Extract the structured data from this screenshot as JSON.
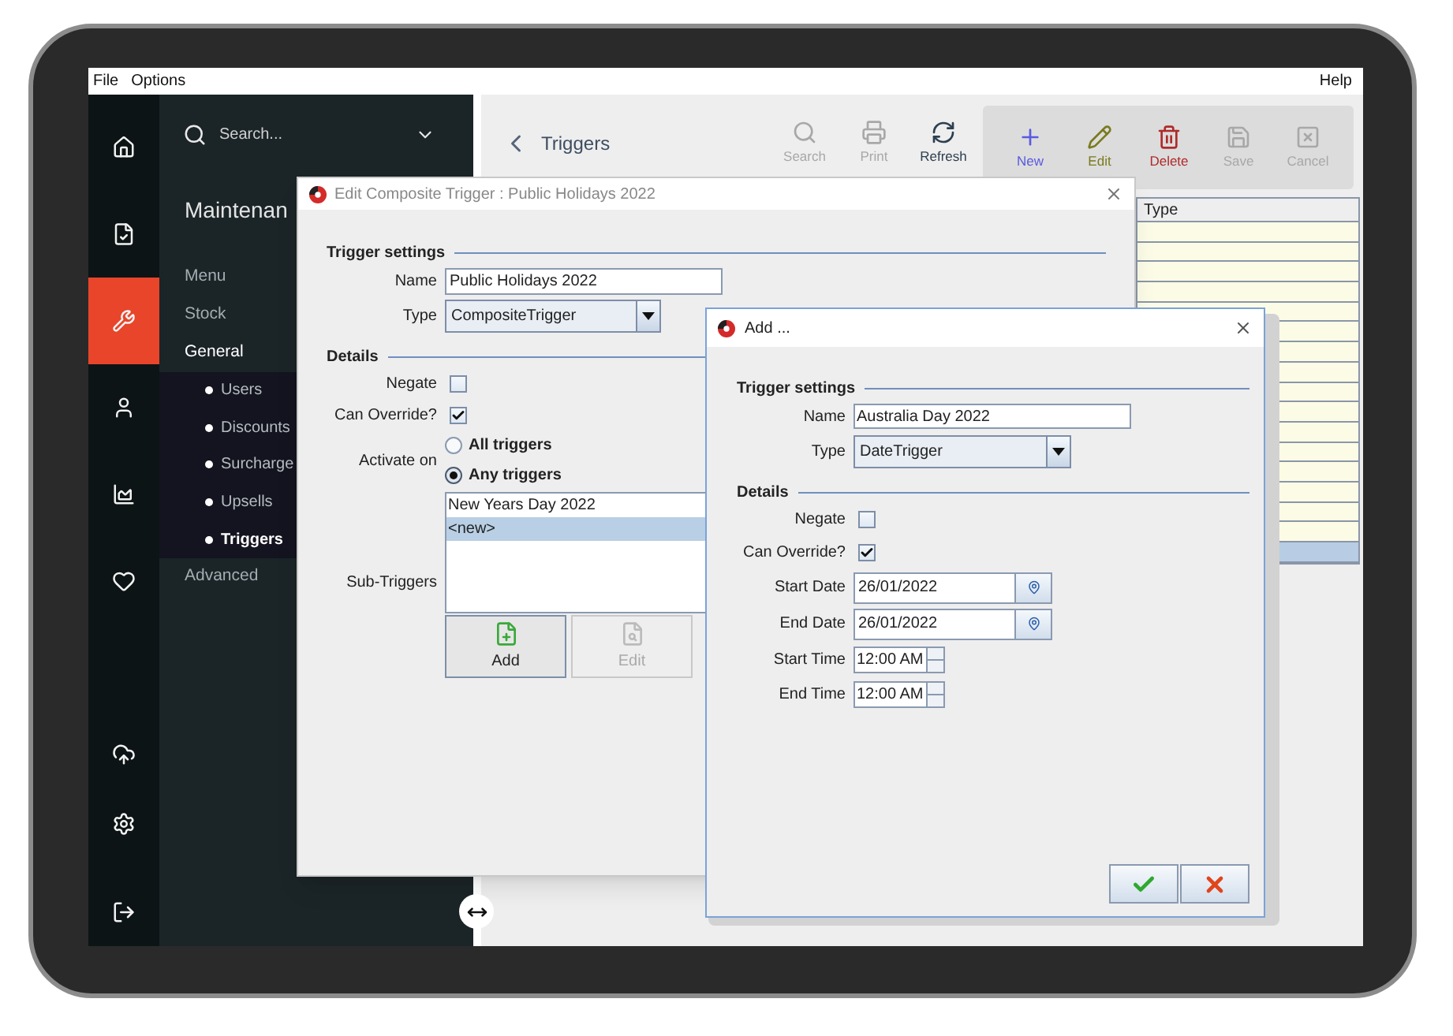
{
  "menu_bar": {
    "left": [
      "File",
      "Options"
    ],
    "right": "Help"
  },
  "rail": [
    {
      "selected": false
    },
    {
      "selected": false
    },
    {
      "selected": true
    },
    {
      "selected": false
    },
    {
      "selected": false
    },
    {
      "selected": false
    },
    {
      "selected": false
    },
    {
      "selected": false
    },
    {
      "selected": false
    }
  ],
  "nav": {
    "search_placeholder": "Search...",
    "title": "Maintenan",
    "items": [
      {
        "label": "Menu",
        "selected": false
      },
      {
        "label": "Stock",
        "selected": false
      },
      {
        "label": "General",
        "selected": true,
        "children": [
          {
            "label": "Users",
            "selected": false
          },
          {
            "label": "Discounts",
            "selected": false
          },
          {
            "label": "Surcharge",
            "selected": false
          },
          {
            "label": "Upsells",
            "selected": false
          },
          {
            "label": "Triggers",
            "selected": true
          }
        ]
      },
      {
        "label": "Advanced",
        "selected": false
      }
    ]
  },
  "page": {
    "title": "Triggers"
  },
  "toolbar": [
    {
      "label": "Search",
      "disabled": true
    },
    {
      "label": "Print",
      "disabled": true
    },
    {
      "label": "Refresh",
      "disabled": false,
      "color": "#2d3f4f"
    }
  ],
  "actions": [
    {
      "label": "New",
      "disabled": false,
      "color": "#5a5ae0"
    },
    {
      "label": "Edit",
      "disabled": false,
      "color": "#7a7a20"
    },
    {
      "label": "Delete",
      "disabled": false,
      "color": "#b02a2a"
    },
    {
      "label": "Save",
      "disabled": true
    },
    {
      "label": "Cancel",
      "disabled": true
    }
  ],
  "table": {
    "columns": [
      "Type"
    ],
    "rows": [
      {
        "selected": false
      },
      {
        "selected": false
      },
      {
        "selected": false
      },
      {
        "selected": false
      },
      {
        "selected": false
      },
      {
        "selected": false
      },
      {
        "selected": false
      },
      {
        "selected": false
      },
      {
        "selected": false
      },
      {
        "selected": false
      },
      {
        "selected": false
      },
      {
        "selected": false
      },
      {
        "selected": false
      },
      {
        "selected": false
      },
      {
        "selected": false
      },
      {
        "selected": false
      },
      {
        "selected": true
      }
    ]
  },
  "edit_dialog": {
    "title": "Edit Composite Trigger : Public Holidays 2022",
    "settings_heading": "Trigger settings",
    "name_label": "Name",
    "name_value": "Public Holidays 2022",
    "type_label": "Type",
    "type_value": "CompositeTrigger",
    "details_heading": "Details",
    "checks": [
      {
        "label": "Negate",
        "checked": false
      },
      {
        "label": "Can Override?",
        "checked": true
      }
    ],
    "activate_label": "Activate on",
    "activate_options": [
      {
        "label": "All triggers",
        "selected": false
      },
      {
        "label": "Any triggers",
        "selected": true
      }
    ],
    "sub_label": "Sub-Triggers",
    "sub_items": [
      {
        "label": "New Years Day 2022",
        "selected": false
      },
      {
        "label": "<new>",
        "selected": true
      }
    ],
    "sub_buttons": [
      {
        "label": "Add",
        "disabled": false
      },
      {
        "label": "Edit",
        "disabled": true
      }
    ]
  },
  "add_dialog": {
    "title": "Add ...",
    "settings_heading": "Trigger settings",
    "name_label": "Name",
    "name_value": "Australia Day 2022",
    "type_label": "Type",
    "type_value": "DateTrigger",
    "details_heading": "Details",
    "checks": [
      {
        "label": "Negate",
        "checked": false
      },
      {
        "label": "Can Override?",
        "checked": true
      }
    ],
    "dates": [
      {
        "label": "Start Date",
        "value": "26/01/2022"
      },
      {
        "label": "End Date",
        "value": "26/01/2022"
      }
    ],
    "times": [
      {
        "label": "Start Time",
        "value": "12:00 AM"
      },
      {
        "label": "End Time",
        "value": "12:00 AM"
      }
    ]
  }
}
